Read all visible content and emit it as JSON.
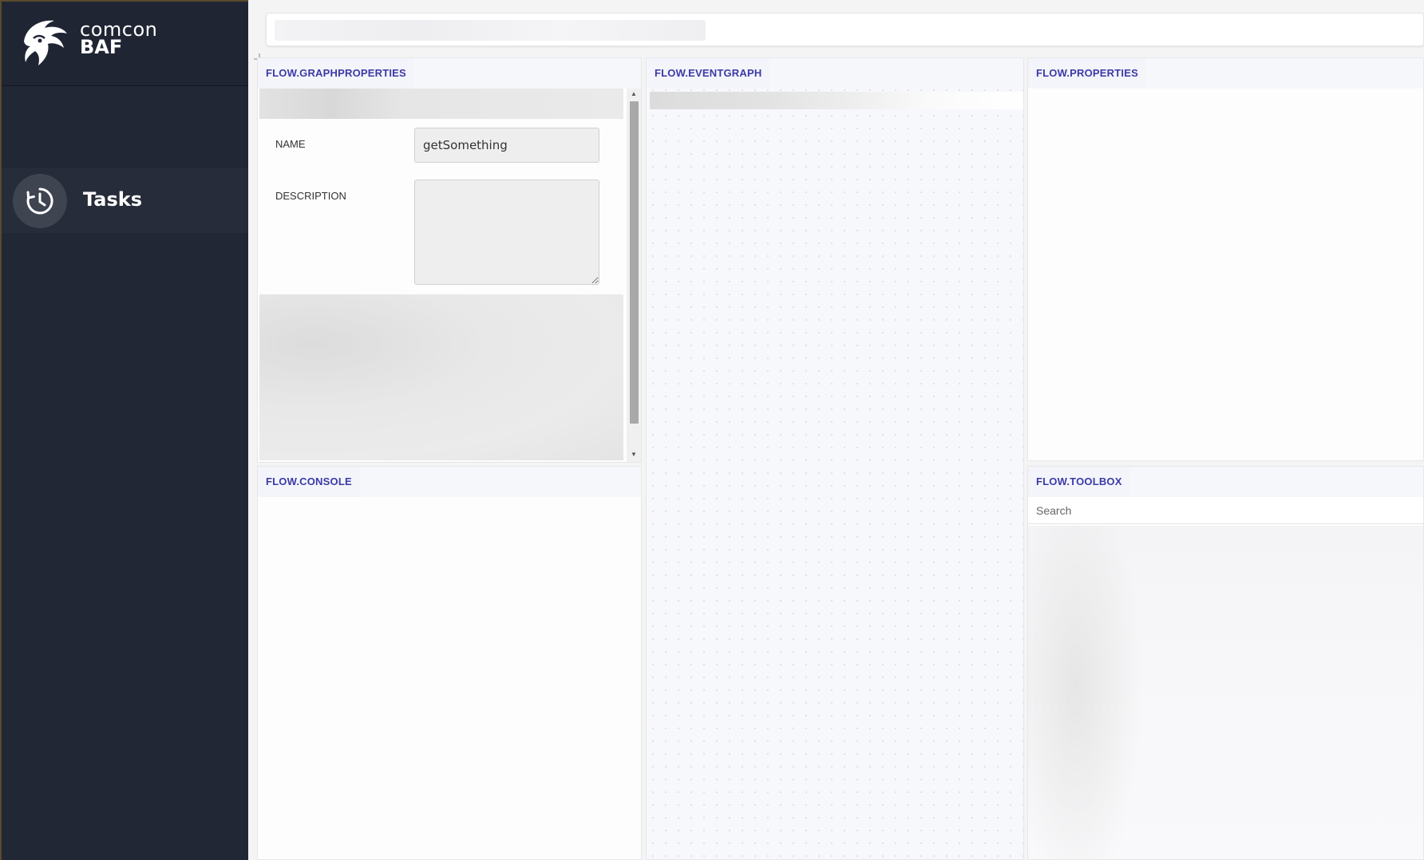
{
  "brand": {
    "line1": "comcon",
    "line2": "BAF"
  },
  "sidebar": {
    "items": [
      {
        "label": "Tasks",
        "icon": "clock-history-icon"
      }
    ]
  },
  "panels": {
    "graph_properties": {
      "title": "FLOW.GRAPHPROPERTIES",
      "name_label": "NAME",
      "name_value": "getSomething",
      "description_label": "DESCRIPTION",
      "description_value": ""
    },
    "event_graph": {
      "title": "FLOW.EVENTGRAPH"
    },
    "properties": {
      "title": "FLOW.PROPERTIES"
    },
    "console": {
      "title": "FLOW.CONSOLE"
    },
    "toolbox": {
      "title": "FLOW.TOOLBOX",
      "search_placeholder": "Search"
    }
  },
  "colors": {
    "sidebar_bg": "#212735",
    "panel_title": "#3c3aa6",
    "page_bg": "#f4f4f5"
  }
}
